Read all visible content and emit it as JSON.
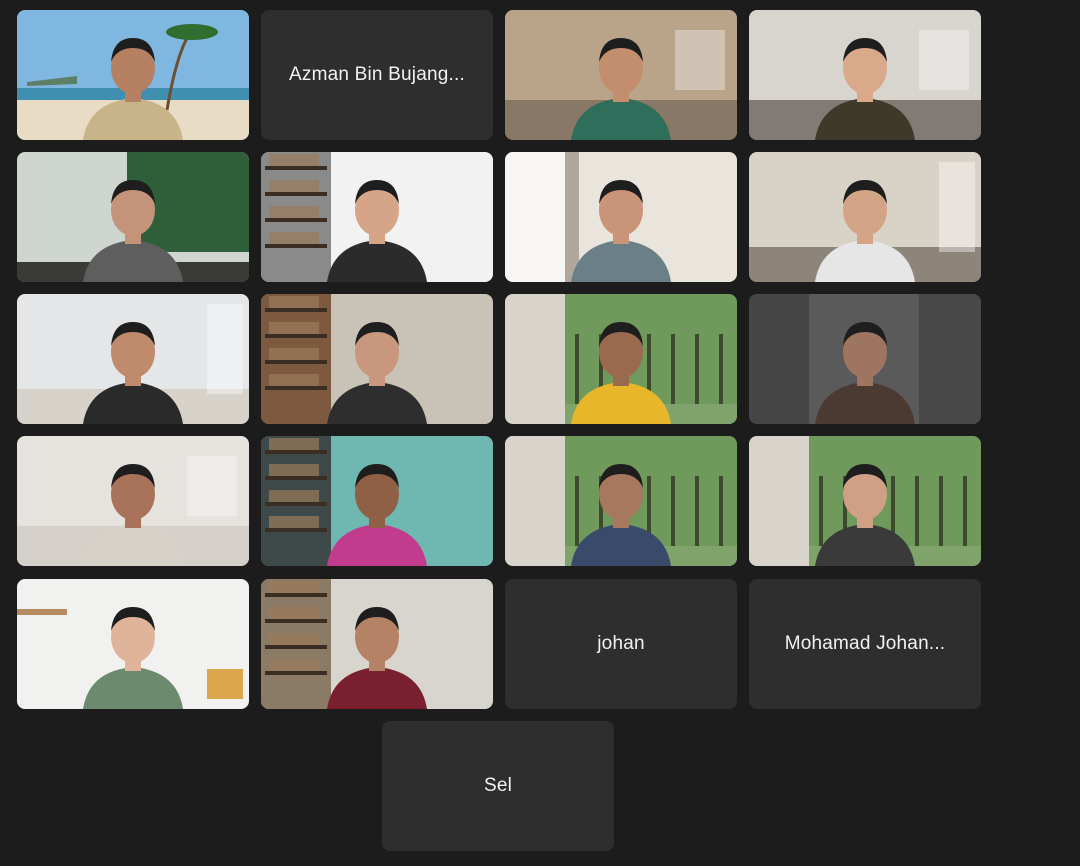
{
  "meeting": {
    "participants": [
      {
        "name": "",
        "video": true,
        "scene": "beach",
        "palette": {
          "bg": "#7fb7e0",
          "ground": "#e8dcc4",
          "shirt": "#c9b48a",
          "skin": "#b58162"
        }
      },
      {
        "name": "Azman Bin Bujang...",
        "video": false
      },
      {
        "name": "",
        "video": true,
        "scene": "office",
        "palette": {
          "bg": "#b9a48a",
          "ground": "#6b5c4e",
          "shirt": "#2f6e5a",
          "skin": "#c28e6e"
        }
      },
      {
        "name": "",
        "video": true,
        "scene": "office",
        "palette": {
          "bg": "#d8d5cf",
          "ground": "#4a4038",
          "shirt": "#3d3a2a",
          "skin": "#d9a98a"
        }
      },
      {
        "name": "",
        "video": true,
        "scene": "lobby",
        "palette": {
          "bg": "#cfd6cf",
          "ground": "#2f5f38",
          "shirt": "#5e5e5e",
          "skin": "#c4937a"
        }
      },
      {
        "name": "",
        "video": true,
        "scene": "shelf",
        "palette": {
          "bg": "#f2f2f2",
          "ground": "#8a8a8a",
          "shirt": "#2b2b2b",
          "skin": "#d6a486"
        }
      },
      {
        "name": "",
        "video": true,
        "scene": "window",
        "palette": {
          "bg": "#e9e4dc",
          "ground": "#7a6a58",
          "shirt": "#6a7f86",
          "skin": "#c99478"
        }
      },
      {
        "name": "",
        "video": true,
        "scene": "room",
        "palette": {
          "bg": "#d9d2c6",
          "ground": "#5c5248",
          "shirt": "#e6e6e6",
          "skin": "#d4a487"
        }
      },
      {
        "name": "",
        "video": true,
        "scene": "room",
        "palette": {
          "bg": "#e4e6e8",
          "ground": "#cfc7b8",
          "shirt": "#2a2a2a",
          "skin": "#c08a6d"
        }
      },
      {
        "name": "",
        "video": true,
        "scene": "shelf",
        "palette": {
          "bg": "#c9c2b6",
          "ground": "#7d5a3f",
          "shirt": "#2e2e2e",
          "skin": "#c9977d"
        }
      },
      {
        "name": "",
        "video": true,
        "scene": "trees",
        "palette": {
          "bg": "#6f9a5c",
          "ground": "#d8d4cc",
          "shirt": "#e8b62a",
          "skin": "#9a6a4e"
        }
      },
      {
        "name": "",
        "video": true,
        "scene": "blur",
        "palette": {
          "bg": "#5a5a5a",
          "ground": "#3c3c3c",
          "shirt": "#4a3a32",
          "skin": "#9e7560"
        }
      },
      {
        "name": "",
        "video": true,
        "scene": "office",
        "palette": {
          "bg": "#e6e3de",
          "ground": "#c9c4bc",
          "shirt": "#d6d2c8",
          "skin": "#a8735a"
        }
      },
      {
        "name": "",
        "video": true,
        "scene": "shelf",
        "palette": {
          "bg": "#6fb8b2",
          "ground": "#3e4a4a",
          "shirt": "#c23c8e",
          "skin": "#8f5f46"
        }
      },
      {
        "name": "",
        "video": true,
        "scene": "trees",
        "palette": {
          "bg": "#6f9a5c",
          "ground": "#d8d4cc",
          "shirt": "#3a4a6a",
          "skin": "#a8785e"
        }
      },
      {
        "name": "",
        "video": true,
        "scene": "trees",
        "palette": {
          "bg": "#6f9a5c",
          "ground": "#d8d4cc",
          "shirt": "#3a3a3a",
          "skin": "#d0a086"
        }
      },
      {
        "name": "",
        "video": true,
        "scene": "wall",
        "palette": {
          "bg": "#f1f1ef",
          "ground": "#e2dcd0",
          "shirt": "#6c8a6e",
          "skin": "#e0b49a"
        }
      },
      {
        "name": "",
        "video": true,
        "scene": "shelf",
        "palette": {
          "bg": "#d8d4ce",
          "ground": "#8a7a66",
          "shirt": "#7a1f2e",
          "skin": "#b58266"
        }
      },
      {
        "name": "johan",
        "video": false
      },
      {
        "name": "Mohamad Johan...",
        "video": false
      },
      {
        "name": "Sel",
        "video": false
      }
    ]
  }
}
